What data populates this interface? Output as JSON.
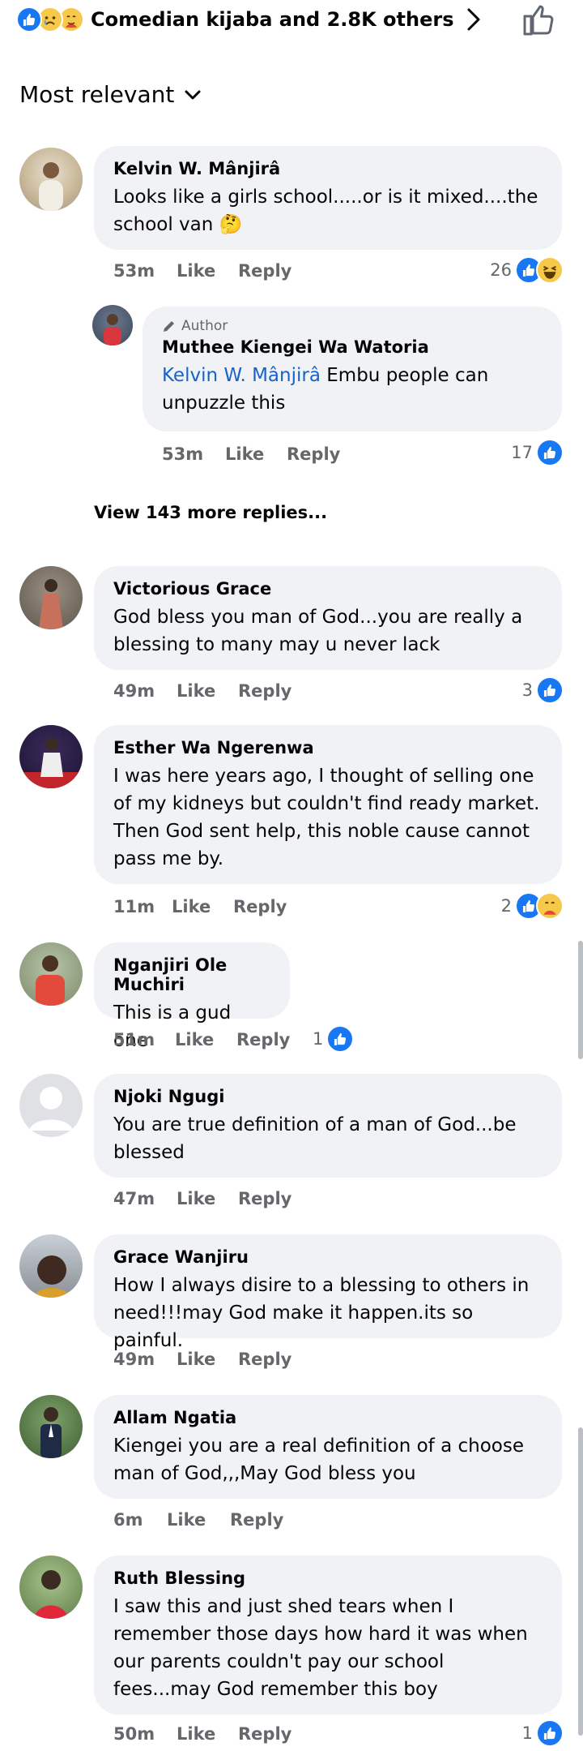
{
  "summary": {
    "text": "Comedian kijaba and 2.8K others"
  },
  "sort": {
    "label": "Most relevant"
  },
  "comments": [
    {
      "name": "Kelvin W. Mânjirâ",
      "lines": [
        "Looks like a girls school.....or is it mixed....the",
        "school van 🤔"
      ],
      "time": "53m",
      "like": "Like",
      "reply": "Reply",
      "count": "26"
    },
    {
      "tag": "Author",
      "name": "Muthee Kiengei Wa Watoria",
      "mention": "Kelvin W. Mânjirâ",
      "line1": " Embu people can",
      "line2": "unpuzzle this",
      "time": "53m",
      "like": "Like",
      "reply": "Reply",
      "count": "17"
    },
    {
      "name": "Victorious Grace",
      "lines": [
        "God bless you man of God...you are really a",
        "blessing to many may u never lack"
      ],
      "time": "49m",
      "like": "Like",
      "reply": "Reply",
      "count": "3"
    },
    {
      "name": "Esther Wa Ngerenwa",
      "lines": [
        "I was here years ago, I thought of selling one",
        "of my kidneys but couldn't find ready market.",
        "Then God sent help, this noble cause cannot",
        "pass me by."
      ],
      "time": "11m",
      "like": "Like",
      "reply": "Reply",
      "count": "2"
    },
    {
      "name": "Nganjiri Ole Muchiri",
      "lines": [
        "This is a gud one"
      ],
      "time": "51m",
      "like": "Like",
      "reply": "Reply",
      "count": "1"
    },
    {
      "name": "Njoki Ngugi",
      "lines": [
        "You are true definition of a man of God...be",
        "blessed"
      ],
      "time": "47m",
      "like": "Like",
      "reply": "Reply"
    },
    {
      "name": "Grace Wanjiru",
      "lines": [
        "How I always disire to a blessing to others in",
        "need!!!may God make it happen.its so painful."
      ],
      "time": "49m",
      "like": "Like",
      "reply": "Reply"
    },
    {
      "name": "Allam Ngatia",
      "lines": [
        "Kiengei you are a real definition of a choose",
        "man of God,,,May God bless you"
      ],
      "time": "6m",
      "like": "Like",
      "reply": "Reply"
    },
    {
      "name": "Ruth Blessing",
      "lines": [
        "I saw  this and just shed tears when I",
        "remember those days how hard it was when",
        "our parents couldn't pay our school",
        "fees...may God remember this boy"
      ],
      "time": "50m",
      "like": "Like",
      "reply": "Reply",
      "count": "1"
    }
  ],
  "view_more": {
    "label": "View 143 more replies..."
  },
  "colors": {
    "like_blue": "#1877f2",
    "mention": "#1862c9",
    "bubble": "#f0f2f5",
    "meta": "#65676b"
  },
  "icons": [
    "like-reaction-icon",
    "sad-reaction-icon",
    "care-reaction-icon",
    "haha-reaction-icon",
    "chevron-right-icon",
    "thumbs-up-outline-icon",
    "chevron-down-icon",
    "pencil-icon"
  ]
}
